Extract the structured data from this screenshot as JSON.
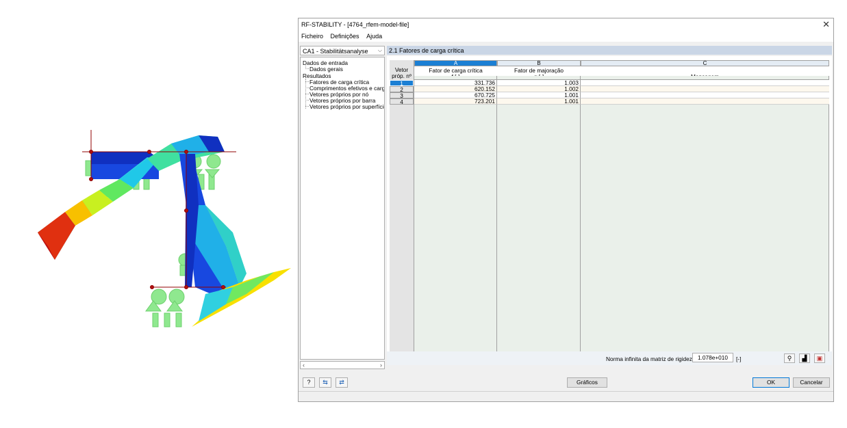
{
  "window": {
    "title": "RF-STABILITY - [4764_rfem-model-file]"
  },
  "menu": [
    "Ficheiro",
    "Definições",
    "Ajuda"
  ],
  "case_select": {
    "value": "CA1 - Stabilitätsanalyse"
  },
  "tree": {
    "input_root": "Dados de entrada",
    "input_items": [
      "Dados gerais"
    ],
    "results_root": "Resultados",
    "results_items": [
      "Fatores de carga crítica",
      "Comprimentos efetivos e carga",
      "Vetores próprios por nó",
      "Vetores próprios por barra",
      "Vetores próprios por superfície"
    ]
  },
  "section_title": "2.1 Fatores de carga crítica",
  "table": {
    "col_letters": [
      "A",
      "B",
      "C"
    ],
    "rowhead_label1": "Vetor",
    "rowhead_label2": "próp. nº",
    "headers": [
      {
        "line1": "Fator de carga crítica",
        "line2": "f [-]"
      },
      {
        "line1": "Fator de majoração",
        "line2": "α [-]"
      },
      {
        "line1": "",
        "line2": "Mensagem"
      }
    ],
    "rows": [
      {
        "no": "1",
        "f": "331.736",
        "alpha": "1.003",
        "msg": ""
      },
      {
        "no": "2",
        "f": "620.152",
        "alpha": "1.002",
        "msg": ""
      },
      {
        "no": "3",
        "f": "670.725",
        "alpha": "1.001",
        "msg": ""
      },
      {
        "no": "4",
        "f": "723.201",
        "alpha": "1.001",
        "msg": ""
      }
    ]
  },
  "status": {
    "label": "Norma infinita da matriz de rigidez:",
    "value": "1.078e+010",
    "unit": "[-]"
  },
  "buttons": {
    "graphics": "Gráficos",
    "ok": "OK",
    "cancel": "Cancelar"
  },
  "icons": [
    "help-icon",
    "export-icon",
    "import-icon",
    "filter-icon",
    "chart-icon",
    "excel-icon"
  ],
  "colors": {
    "header_blue": "#cad6e6",
    "selected_col": "#1b7fd4",
    "odd_row": "#fdf8ee"
  }
}
